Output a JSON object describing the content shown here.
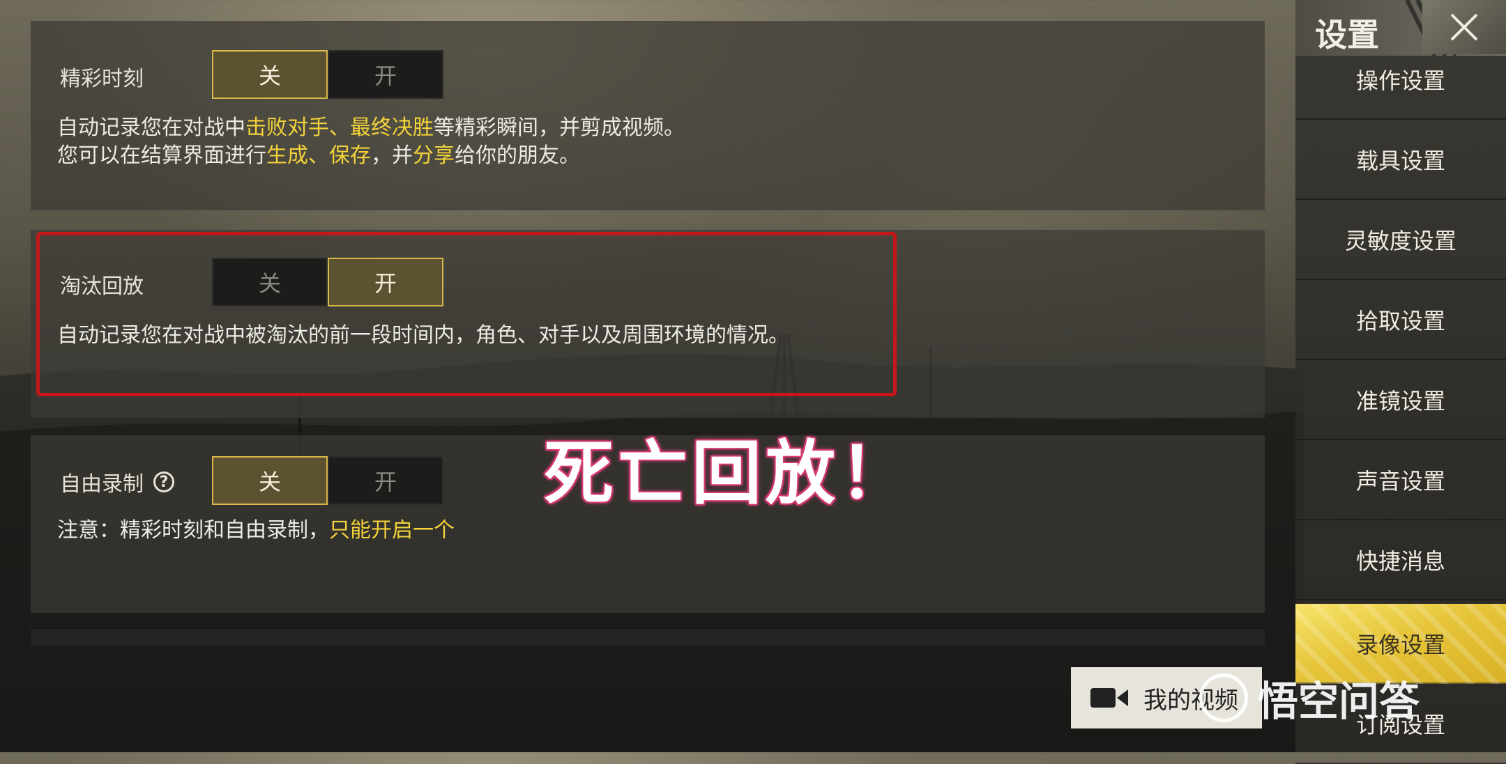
{
  "settings_panels": [
    {
      "label": "精彩时刻",
      "toggle": {
        "off": "关",
        "on": "开",
        "selected": "off"
      },
      "desc_line1": {
        "a": "自动记录您在对战中",
        "b": "击败对手、最终决胜",
        "c": "等精彩瞬间，并剪成视频。"
      },
      "desc_line2": {
        "a": "您可以在结算界面进行",
        "b": "生成、保存",
        "c": "，并",
        "d": "分享",
        "e": "给你的朋友。"
      }
    },
    {
      "label": "淘汰回放",
      "toggle": {
        "off": "关",
        "on": "开",
        "selected": "on"
      },
      "desc": "自动记录您在对战中被淘汰的前一段时间内，角色、对手以及周围环境的情况。"
    },
    {
      "label": "自由录制",
      "help_icon": "question-circle-icon",
      "toggle": {
        "off": "关",
        "on": "开",
        "selected": "off"
      },
      "note": {
        "a": "注意：精彩时刻和自由录制，",
        "b": "只能开启一个"
      }
    }
  ],
  "overlay_caption": "死亡回放！",
  "sidebar": {
    "title": "设置",
    "close_icon": "close-icon",
    "items": [
      {
        "label": "操作设置"
      },
      {
        "label": "载具设置"
      },
      {
        "label": "灵敏度设置"
      },
      {
        "label": "拾取设置"
      },
      {
        "label": "准镜设置"
      },
      {
        "label": "声音设置"
      },
      {
        "label": "快捷消息"
      },
      {
        "label": "录像设置",
        "active": true
      },
      {
        "label": "订阅设置"
      }
    ]
  },
  "my_video_button": {
    "label": "我的视频",
    "icon": "video-camera-icon"
  },
  "watermark": {
    "text": "悟空问答"
  },
  "colors": {
    "highlight": "#f3d23a",
    "toggle_on_border": "#d9b84a",
    "red_box": "#c4171b",
    "active_tab": "#e6c53a"
  }
}
